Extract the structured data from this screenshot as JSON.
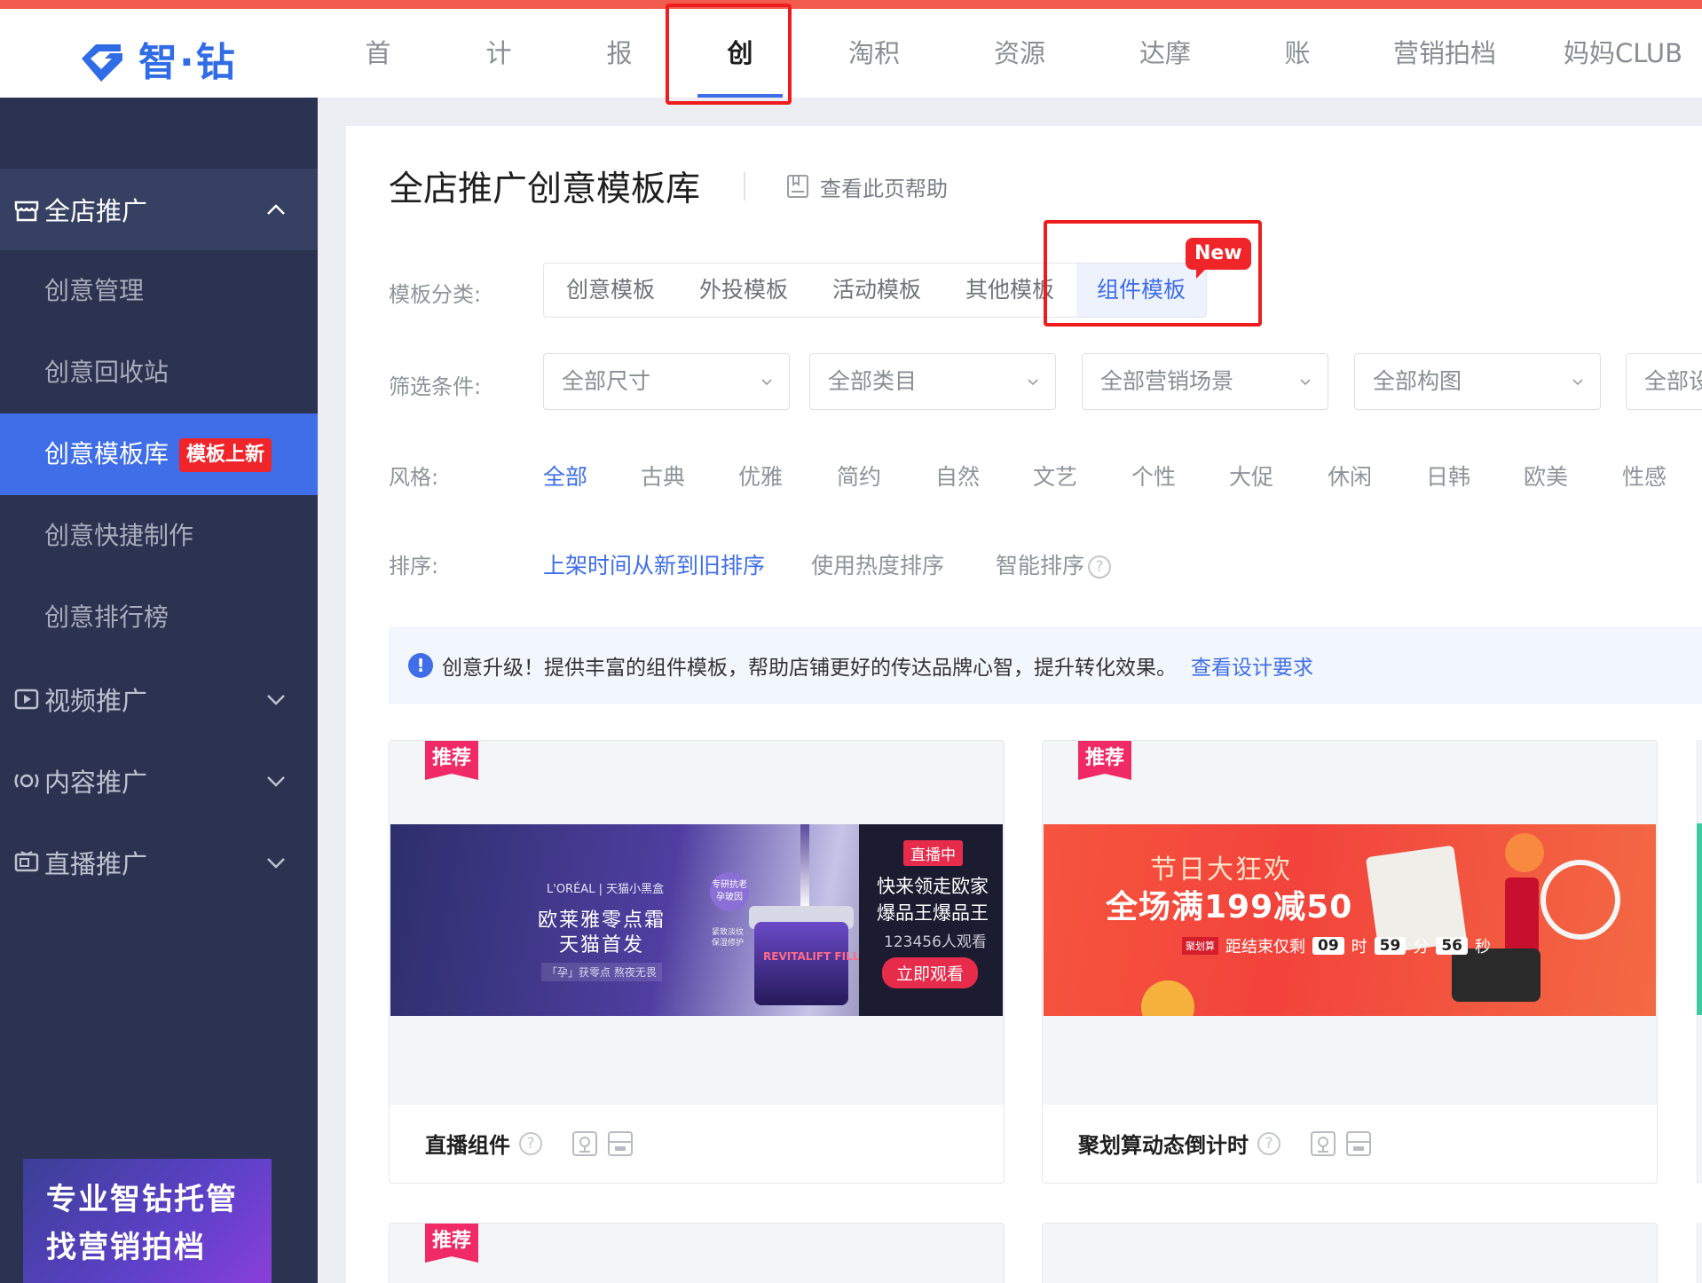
{
  "brand": {
    "logo_text": "智·钻"
  },
  "nav": [
    {
      "label": "首页"
    },
    {
      "label": "计划"
    },
    {
      "label": "报表"
    },
    {
      "label": "创意"
    },
    {
      "label": "淘积木"
    },
    {
      "label": "资源位"
    },
    {
      "label": "达摩盘"
    },
    {
      "label": "账户"
    },
    {
      "label": "营销拍档"
    },
    {
      "label": "妈妈CLUB"
    }
  ],
  "nav_active": "创意",
  "sidebar": {
    "groups": [
      {
        "label": "全店推广",
        "icon": "store-icon",
        "state": "expanded"
      },
      {
        "label": "视频推广",
        "icon": "video-icon",
        "state": "collapsed"
      },
      {
        "label": "内容推广",
        "icon": "content-icon",
        "state": "collapsed"
      },
      {
        "label": "直播推广",
        "icon": "live-icon",
        "state": "collapsed"
      }
    ],
    "items": [
      {
        "label": "创意管理"
      },
      {
        "label": "创意回收站"
      },
      {
        "label": "创意模板库",
        "badge": "模板上新",
        "active": true
      },
      {
        "label": "创意快捷制作"
      },
      {
        "label": "创意排行榜"
      }
    ],
    "promo": {
      "line1": "专业智钻托管",
      "line2": "找营销拍档"
    }
  },
  "main": {
    "title": "全店推广创意模板库",
    "help_label": "查看此页帮助",
    "category_label": "模板分类:",
    "tabs": [
      {
        "label": "创意模板"
      },
      {
        "label": "外投模板"
      },
      {
        "label": "活动模板"
      },
      {
        "label": "其他模板"
      },
      {
        "label": "组件模板",
        "active": true
      }
    ],
    "new_badge": "New",
    "filter_label": "筛选条件:",
    "filters": [
      {
        "value": "全部尺寸"
      },
      {
        "value": "全部类目"
      },
      {
        "value": "全部营销场景"
      },
      {
        "value": "全部构图"
      },
      {
        "value": "全部设"
      }
    ],
    "style_label": "风格:",
    "styles": [
      "全部",
      "古典",
      "优雅",
      "简约",
      "自然",
      "文艺",
      "个性",
      "大促",
      "休闲",
      "日韩",
      "欧美",
      "性感"
    ],
    "style_active": "全部",
    "sort_label": "排序:",
    "sorts": [
      {
        "label": "上架时间从新到旧排序",
        "active": true
      },
      {
        "label": "使用热度排序"
      },
      {
        "label": "智能排序",
        "help": "?"
      }
    ],
    "notice": {
      "icon": "!",
      "text": "创意升级！提供丰富的组件模板，帮助店铺更好的传达品牌心智，提升转化效果。",
      "link": "查看设计要求"
    },
    "cards": [
      {
        "tag": "推荐",
        "name": "直播组件",
        "help": "?",
        "banner": {
          "live": "直播中",
          "line1": "快来领走欧家",
          "line2": "爆品王爆品王",
          "viewers": "123456人观看",
          "button": "立即观看",
          "brand": "L'ORÉAL | 天猫小黑盒",
          "main1": "欧莱雅零点霜",
          "main2": "天猫首发",
          "tagline": "「孕」获零点 熬夜无畏",
          "circle": "专研抗老 孕玻因",
          "side_tag": "紧致淡纹 保湿修护",
          "product": "REVITALIFT FILLER [HA]"
        }
      },
      {
        "tag": "推荐",
        "name": "聚划算动态倒计时",
        "help": "?",
        "banner": {
          "line1": "节日大狂欢",
          "line2": "全场满199减50",
          "jhs": "聚划算",
          "countdown_label": "距结束仅剩",
          "hours": "09",
          "h_unit": "时",
          "minutes": "59",
          "m_unit": "分",
          "seconds": "56",
          "s_unit": "秒"
        }
      },
      {
        "tag": "推荐"
      },
      {}
    ]
  }
}
